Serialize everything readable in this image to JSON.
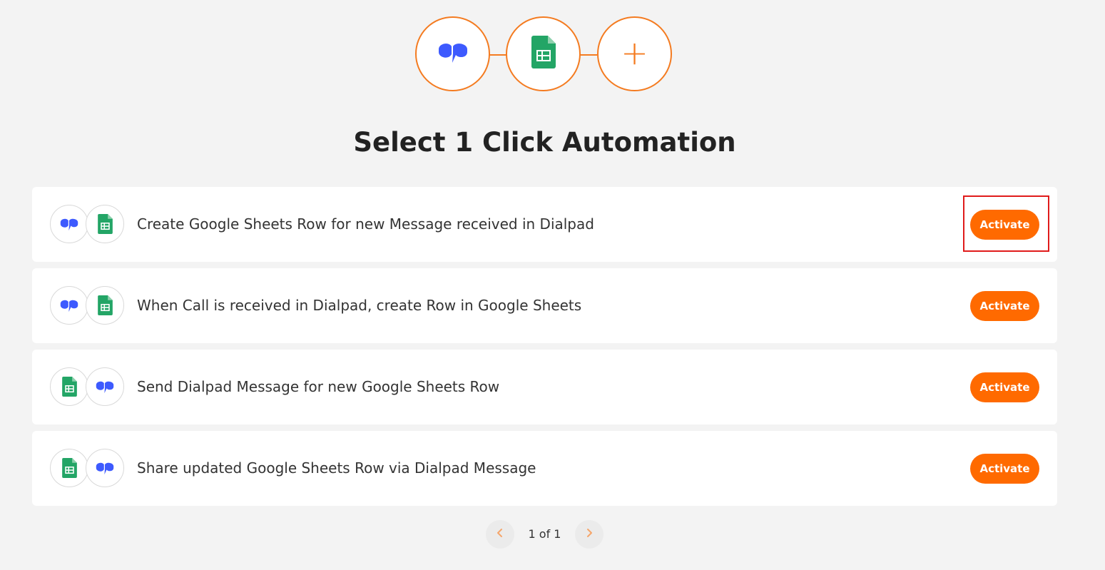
{
  "header": {
    "apps": [
      {
        "name": "Dialpad",
        "icon": "dialpad-icon"
      },
      {
        "name": "Google Sheets",
        "icon": "google-sheets-icon"
      }
    ],
    "add_icon": "plus-icon",
    "add_glyph": "+"
  },
  "title": "Select 1 Click Automation",
  "colors": {
    "accent": "#ff6a00",
    "ring": "#f47b20",
    "dialpad": "#3d5afe",
    "sheets": "#23a566",
    "highlight": "#e01b1b"
  },
  "automations": [
    {
      "text": "Create Google Sheets Row for new Message received in Dialpad",
      "icons": [
        "dialpad-icon",
        "google-sheets-icon"
      ],
      "button_label": "Activate"
    },
    {
      "text": "When Call is received in Dialpad, create Row in Google Sheets",
      "icons": [
        "dialpad-icon",
        "google-sheets-icon"
      ],
      "button_label": "Activate"
    },
    {
      "text": "Send Dialpad Message for new Google Sheets Row",
      "icons": [
        "google-sheets-icon",
        "dialpad-icon"
      ],
      "button_label": "Activate"
    },
    {
      "text": "Share updated Google Sheets Row via Dialpad Message",
      "icons": [
        "google-sheets-icon",
        "dialpad-icon"
      ],
      "button_label": "Activate"
    }
  ],
  "pagination": {
    "label": "1 of 1",
    "prev_icon": "chevron-left-icon",
    "next_icon": "chevron-right-icon"
  }
}
